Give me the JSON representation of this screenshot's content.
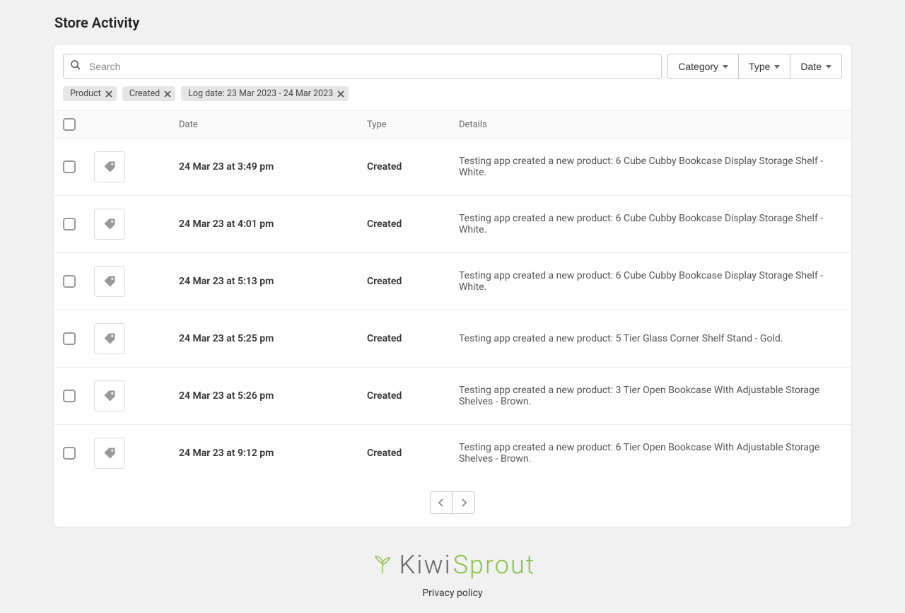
{
  "page": {
    "title": "Store Activity"
  },
  "search": {
    "placeholder": "Search"
  },
  "filters": {
    "buttons": [
      {
        "label": "Category"
      },
      {
        "label": "Type"
      },
      {
        "label": "Date"
      }
    ],
    "chips": [
      {
        "label": "Product"
      },
      {
        "label": "Created"
      },
      {
        "label": "Log date: 23 Mar 2023 - 24 Mar 2023"
      }
    ]
  },
  "table": {
    "headers": {
      "date": "Date",
      "type": "Type",
      "details": "Details"
    },
    "rows": [
      {
        "date": "24 Mar 23 at 3:49 pm",
        "type": "Created",
        "details": "Testing app created a new product: 6 Cube Cubby Bookcase Display Storage Shelf - White."
      },
      {
        "date": "24 Mar 23 at 4:01 pm",
        "type": "Created",
        "details": "Testing app created a new product: 6 Cube Cubby Bookcase Display Storage Shelf - White."
      },
      {
        "date": "24 Mar 23 at 5:13 pm",
        "type": "Created",
        "details": "Testing app created a new product: 6 Cube Cubby Bookcase Display Storage Shelf - White."
      },
      {
        "date": "24 Mar 23 at 5:25 pm",
        "type": "Created",
        "details": "Testing app created a new product: 5 Tier Glass Corner Shelf Stand - Gold."
      },
      {
        "date": "24 Mar 23 at 5:26 pm",
        "type": "Created",
        "details": "Testing app created a new product: 3 Tier Open Bookcase With Adjustable Storage Shelves - Brown."
      },
      {
        "date": "24 Mar 23 at 9:12 pm",
        "type": "Created",
        "details": "Testing app created a new product: 6 Tier Open Bookcase With Adjustable Storage Shelves - Brown."
      }
    ]
  },
  "footer": {
    "brand_kiwi": "Kiwi",
    "brand_sprout": "Sprout",
    "privacy": "Privacy policy"
  }
}
